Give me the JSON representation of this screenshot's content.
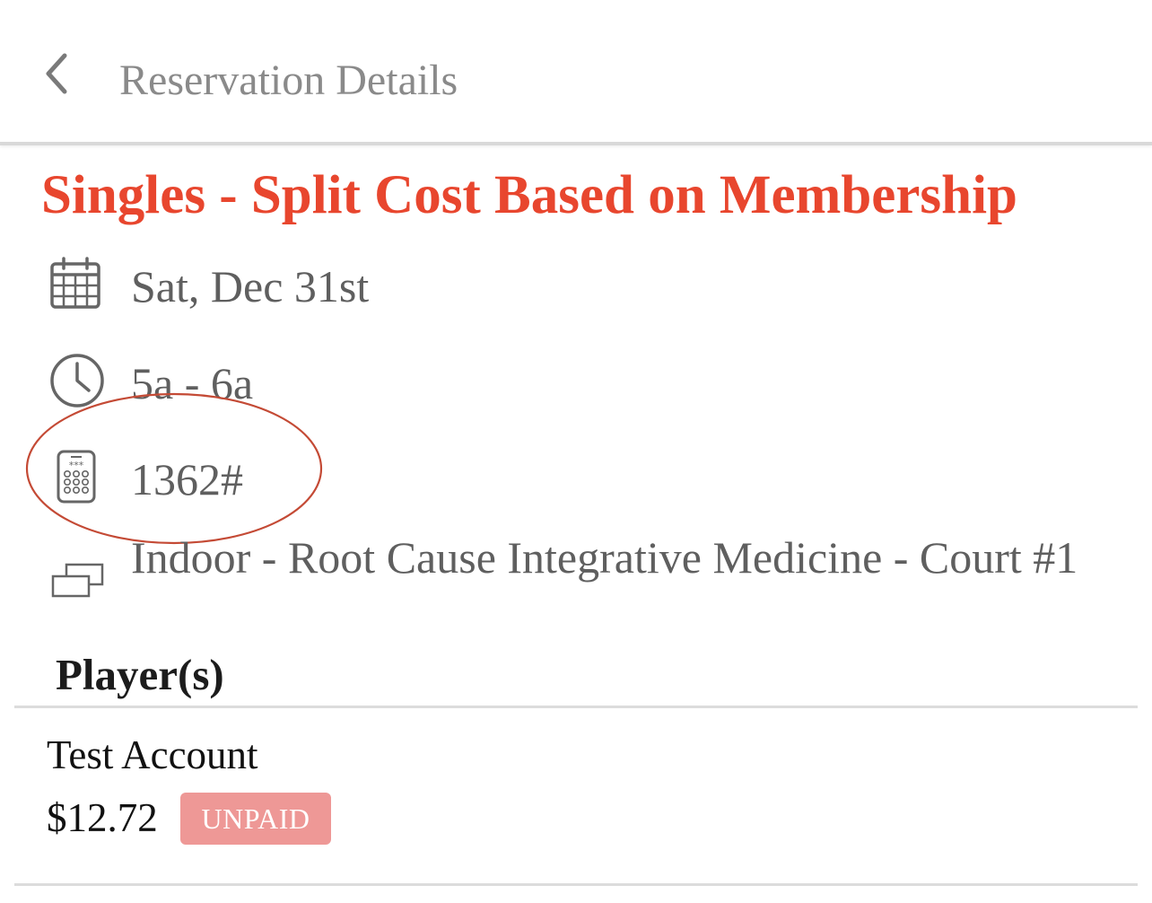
{
  "header": {
    "back_icon": "chevron-left-icon",
    "title": "Reservation Details"
  },
  "reservation": {
    "title": "Singles - Split Cost Based on Membership",
    "title_color": "#e8462e",
    "date": {
      "icon": "calendar-icon",
      "text": "Sat, Dec 31st"
    },
    "time": {
      "icon": "clock-icon",
      "text": "5a - 6a"
    },
    "access_code": {
      "icon": "keypad-icon",
      "text": "1362#",
      "annotation": "red-ellipse-highlight"
    },
    "court": {
      "icon": "courts-icon",
      "text": "Indoor - Root Cause Integrative Medicine - Court #1"
    }
  },
  "players": {
    "heading": "Player(s)",
    "items": [
      {
        "name": "Test Account",
        "amount": "$12.72",
        "status": "UNPAID",
        "status_color": "#ee9896"
      }
    ]
  }
}
